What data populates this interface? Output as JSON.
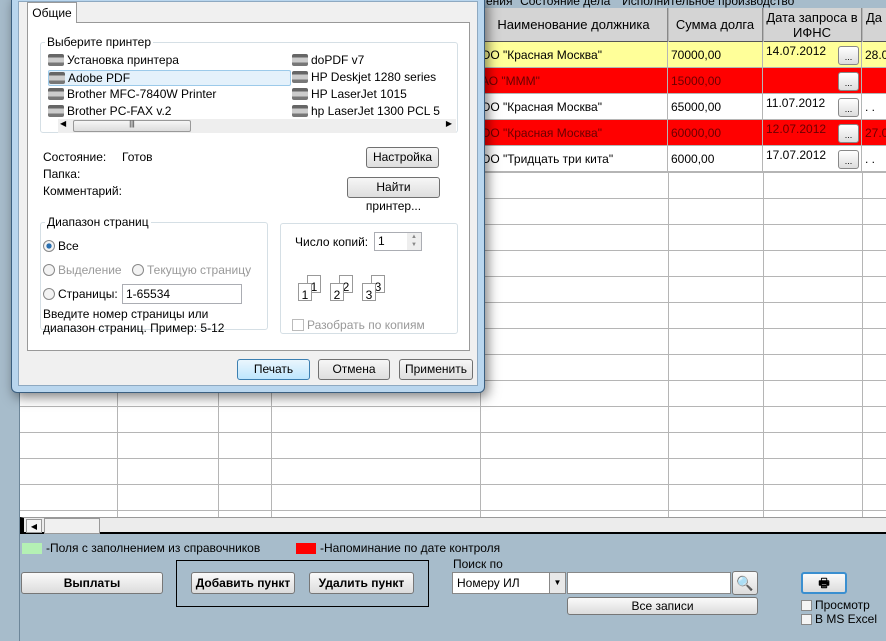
{
  "window": {
    "title_fragment": "ения \"Состояние дела\" \"Исполнительное производство\""
  },
  "grid": {
    "headers": [
      "Наименование должника",
      "Сумма долга",
      "Дата запроса в ИФНС",
      "Да"
    ],
    "rows": [
      {
        "name": "ОО \"Красная Москва\"",
        "sum": "70000,00",
        "date": "14.07.2012",
        "next": "28.0",
        "style": "yellow"
      },
      {
        "name": "АО \"МММ\"",
        "sum": "15000,00",
        "date": "",
        "next": "",
        "style": "red"
      },
      {
        "name": "ОО \"Красная Москва\"",
        "sum": "65000,00",
        "date": "11.07.2012",
        "next": ". .",
        "style": "white"
      },
      {
        "name": "ОО \"Красная Москва\"",
        "sum": "60000,00",
        "date": "12.07.2012",
        "next": "27.0",
        "style": "red"
      },
      {
        "name": "ОО \"Тридцать три кита\"",
        "sum": "6000,00",
        "date": "17.07.2012",
        "next": ". .",
        "style": "white"
      }
    ],
    "ellipsis_label": "..."
  },
  "legend": {
    "green_label": "-Поля с заполнением из справочников",
    "red_label": "-Напоминание по дате контроля",
    "green_color": "#b4f0b4",
    "red_color": "#ff0000"
  },
  "buttons": {
    "payments": "Выплаты",
    "add_item": "Добавить пункт",
    "delete_item": "Удалить пункт",
    "all_records": "Все записи"
  },
  "search": {
    "label": "Поиск по",
    "field": "Номеру ИЛ",
    "value": ""
  },
  "print_options": {
    "preview": "Просмотр",
    "excel": "В MS Excel"
  },
  "dialog": {
    "tab": "Общие",
    "select_printer": "Выберите принтер",
    "printers_left": [
      "Установка принтера",
      "Adobe PDF",
      "Brother MFC-7840W Printer",
      "Brother PC-FAX v.2"
    ],
    "printers_right": [
      "doPDF v7",
      "HP Deskjet 1280 series",
      "HP LaserJet 1015",
      "hp LaserJet 1300 PCL 5"
    ],
    "selected_printer": "Adobe PDF",
    "status_label": "Состояние:",
    "status_value": "Готов",
    "folder_label": "Папка:",
    "comment_label": "Комментарий:",
    "settings_button": "Настройка",
    "find_printer_button": "Найти принтер...",
    "page_range": "Диапазон страниц",
    "all": "Все",
    "selection": "Выделение",
    "current_page": "Текущую страницу",
    "pages": "Страницы:",
    "pages_value": "1-65534",
    "hint": "Введите номер страницы или диапазон страниц.  Пример: 5-12",
    "copies_label": "Число копий:",
    "copies_value": "1",
    "collate": "Разобрать по копиям",
    "collate_digits": [
      "1",
      "1",
      "2",
      "2",
      "3",
      "3"
    ],
    "print_button": "Печать",
    "cancel_button": "Отмена",
    "apply_button": "Применить"
  }
}
